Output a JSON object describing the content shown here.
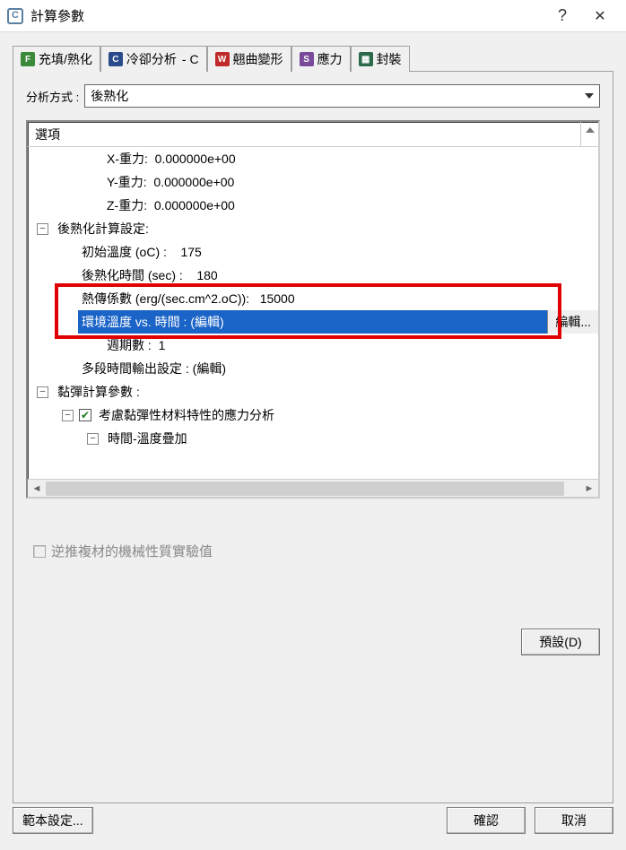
{
  "window": {
    "title": "計算參數"
  },
  "tabs": {
    "filling": "充填/熟化",
    "cooling": "冷卻分析",
    "cooling_suffix": "- C",
    "warp": "翹曲變形",
    "stress": "應力",
    "package": "封裝"
  },
  "form": {
    "analysis_method_label": "分析方式 :",
    "analysis_method_value": "後熟化"
  },
  "tree": {
    "header": "選項",
    "rows": {
      "x_gravity": {
        "label": "X-重力:",
        "value": "0.000000e+00"
      },
      "y_gravity": {
        "label": "Y-重力:",
        "value": "0.000000e+00"
      },
      "z_gravity": {
        "label": "Z-重力:",
        "value": "0.000000e+00"
      },
      "post_cure_settings": "後熟化計算設定:",
      "initial_temp": {
        "label": "初始溫度 (oC) :",
        "value": "175"
      },
      "post_cure_time": {
        "label": "後熟化時間 (sec) :",
        "value": "180"
      },
      "heat_transfer_coef": {
        "label": "熱傳係數 (erg/(sec.cm^2.oC)):",
        "value": "15000"
      },
      "env_temp_vs_time": {
        "label": "環境溫度 vs. 時間 : (編輯)",
        "edit": "編輯..."
      },
      "cycle_count": {
        "label": "週期數 :",
        "value": "1"
      },
      "multi_time_output": "多段時間輸出設定 : (編輯)",
      "viscoelastic_params": "黏彈計算參數 :",
      "consider_visco": "考慮黏彈性材料特性的應力分析",
      "time_temp_superposition": "時間-溫度疊加"
    }
  },
  "disabled_checkbox": "逆推複材的機械性質實驗值",
  "buttons": {
    "default": "預設(D)",
    "template": "範本設定...",
    "ok": "確認",
    "cancel": "取消"
  }
}
